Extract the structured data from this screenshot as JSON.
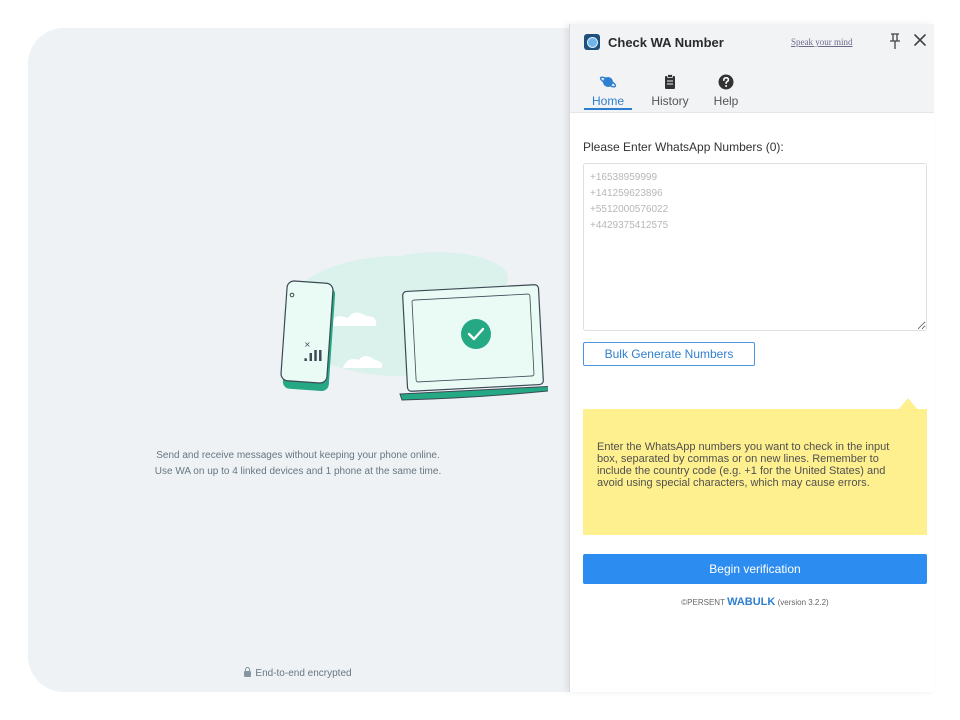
{
  "whatsapp": {
    "caption_line1": "Send and receive messages without keeping your phone online.",
    "caption_line2": "Use WA on up to 4 linked devices and 1 phone at the same time.",
    "encrypted_label": "End-to-end encrypted"
  },
  "extension": {
    "title": "Check WA Number",
    "feedback_link": "Speak your mind",
    "tabs": [
      {
        "label": "Home",
        "icon": "planet-icon",
        "active": true
      },
      {
        "label": "History",
        "icon": "clipboard-icon",
        "active": false
      },
      {
        "label": "Help",
        "icon": "question-icon",
        "active": false
      }
    ],
    "input_label": "Please Enter WhatsApp Numbers (0):",
    "numbers_value": "",
    "numbers_placeholder": "+16538959999\n+141259623896\n+5512000576022\n+4429375412575",
    "bulk_button": "Bulk Generate Numbers",
    "tip_text": "Enter the WhatsApp numbers you want to check in the input box, separated by commas or on new lines. Remember to include the country code (e.g. +1 for the United States) and avoid using special characters, which may cause errors.",
    "begin_button": "Begin verification",
    "footer": {
      "prefix": "©PERSENT",
      "brand": "WABULK",
      "version": "(version 3.2.2)"
    }
  },
  "colors": {
    "accent": "#2d8cf0",
    "tip_background": "#fff08f",
    "wa_teal": "#25a884",
    "panel_background": "#eff2f5"
  }
}
